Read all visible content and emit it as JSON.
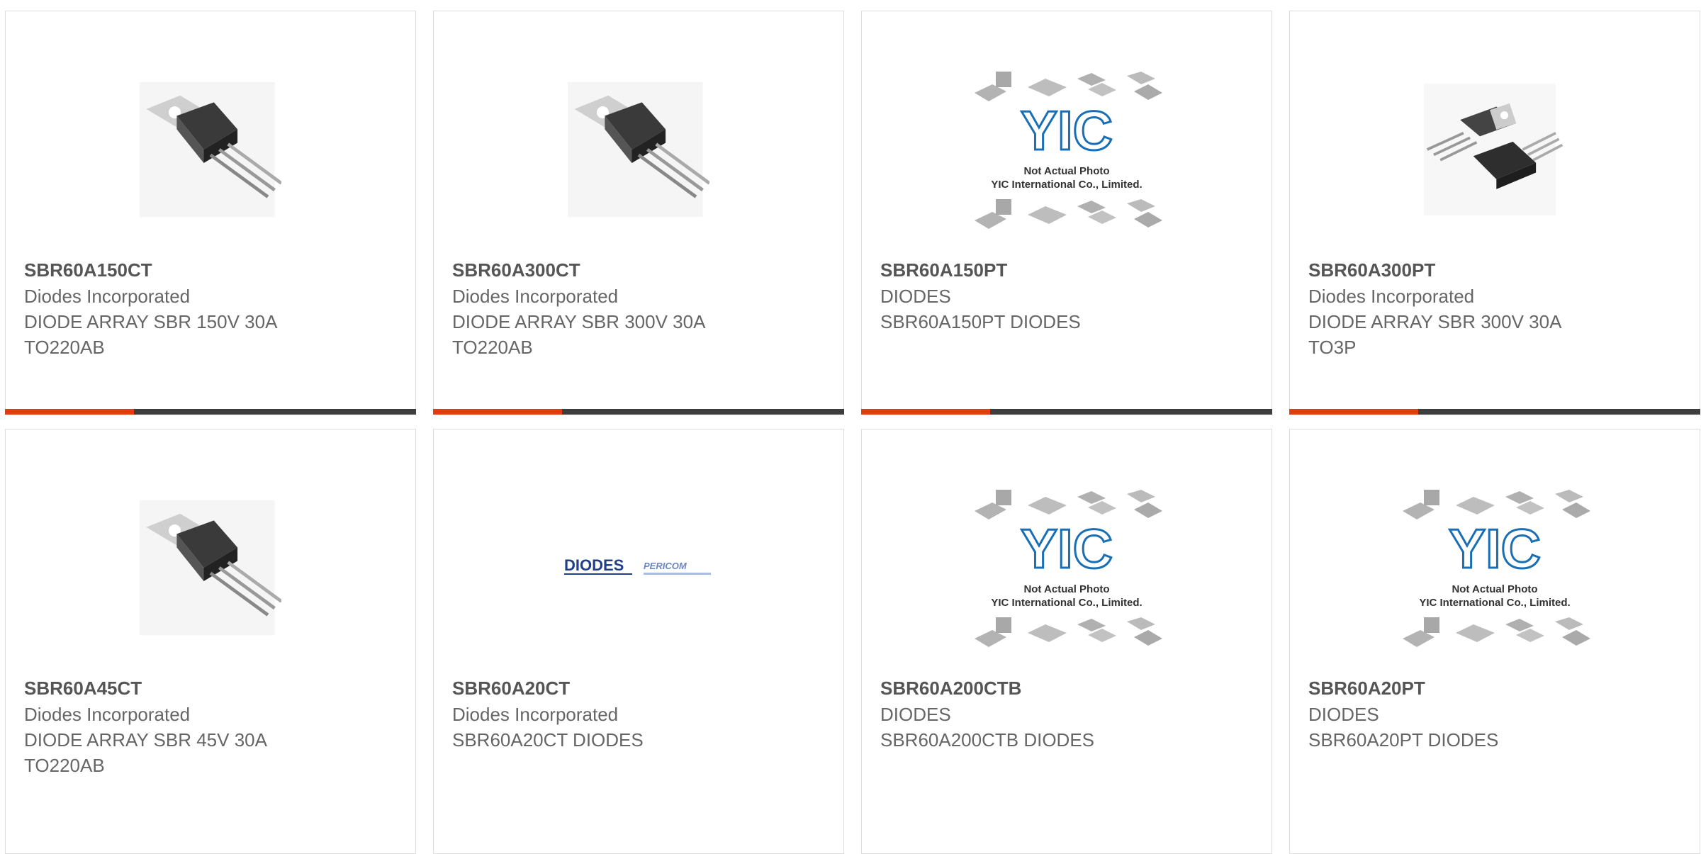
{
  "products": [
    {
      "part": "SBR60A150CT",
      "maker": "Diodes Incorporated",
      "desc1": "DIODE ARRAY SBR 150V 30A",
      "desc2": "TO220AB",
      "image": "to220-transistor-image"
    },
    {
      "part": "SBR60A300CT",
      "maker": "Diodes Incorporated",
      "desc1": "DIODE ARRAY SBR 300V 30A",
      "desc2": "TO220AB",
      "image": "to220-transistor-image"
    },
    {
      "part": "SBR60A150PT",
      "maker": "DIODES",
      "desc1": "SBR60A150PT DIODES",
      "desc2": "",
      "image": "yic-placeholder-image",
      "placeholder_line1": "Not Actual Photo",
      "placeholder_line2": "YIC International Co., Limited.",
      "placeholder_logo": "YIC"
    },
    {
      "part": "SBR60A300PT",
      "maker": "Diodes Incorporated",
      "desc1": "DIODE ARRAY SBR 300V 30A",
      "desc2": "TO3P",
      "image": "to3p-transistor-image"
    },
    {
      "part": "SBR60A45CT",
      "maker": "Diodes Incorporated",
      "desc1": "DIODE ARRAY SBR 45V 30A",
      "desc2": "TO220AB",
      "image": "to220-transistor-image"
    },
    {
      "part": "SBR60A20CT",
      "maker": "Diodes Incorporated",
      "desc1": "SBR60A20CT DIODES",
      "desc2": "",
      "image": "diodes-pericom-logo",
      "logo_a": "DIODES",
      "logo_b": "PERICOM"
    },
    {
      "part": "SBR60A200CTB",
      "maker": "DIODES",
      "desc1": "SBR60A200CTB DIODES",
      "desc2": "",
      "image": "yic-placeholder-image",
      "placeholder_line1": "Not Actual Photo",
      "placeholder_line2": "YIC International Co., Limited.",
      "placeholder_logo": "YIC"
    },
    {
      "part": "SBR60A20PT",
      "maker": "DIODES",
      "desc1": "SBR60A20PT DIODES",
      "desc2": "",
      "image": "yic-placeholder-image",
      "placeholder_line1": "Not Actual Photo",
      "placeholder_line2": "YIC International Co., Limited.",
      "placeholder_logo": "YIC"
    }
  ],
  "colors": {
    "accent": "#e23d11",
    "bar": "#3d3d3d",
    "logo_blue": "#1a6fb4"
  }
}
